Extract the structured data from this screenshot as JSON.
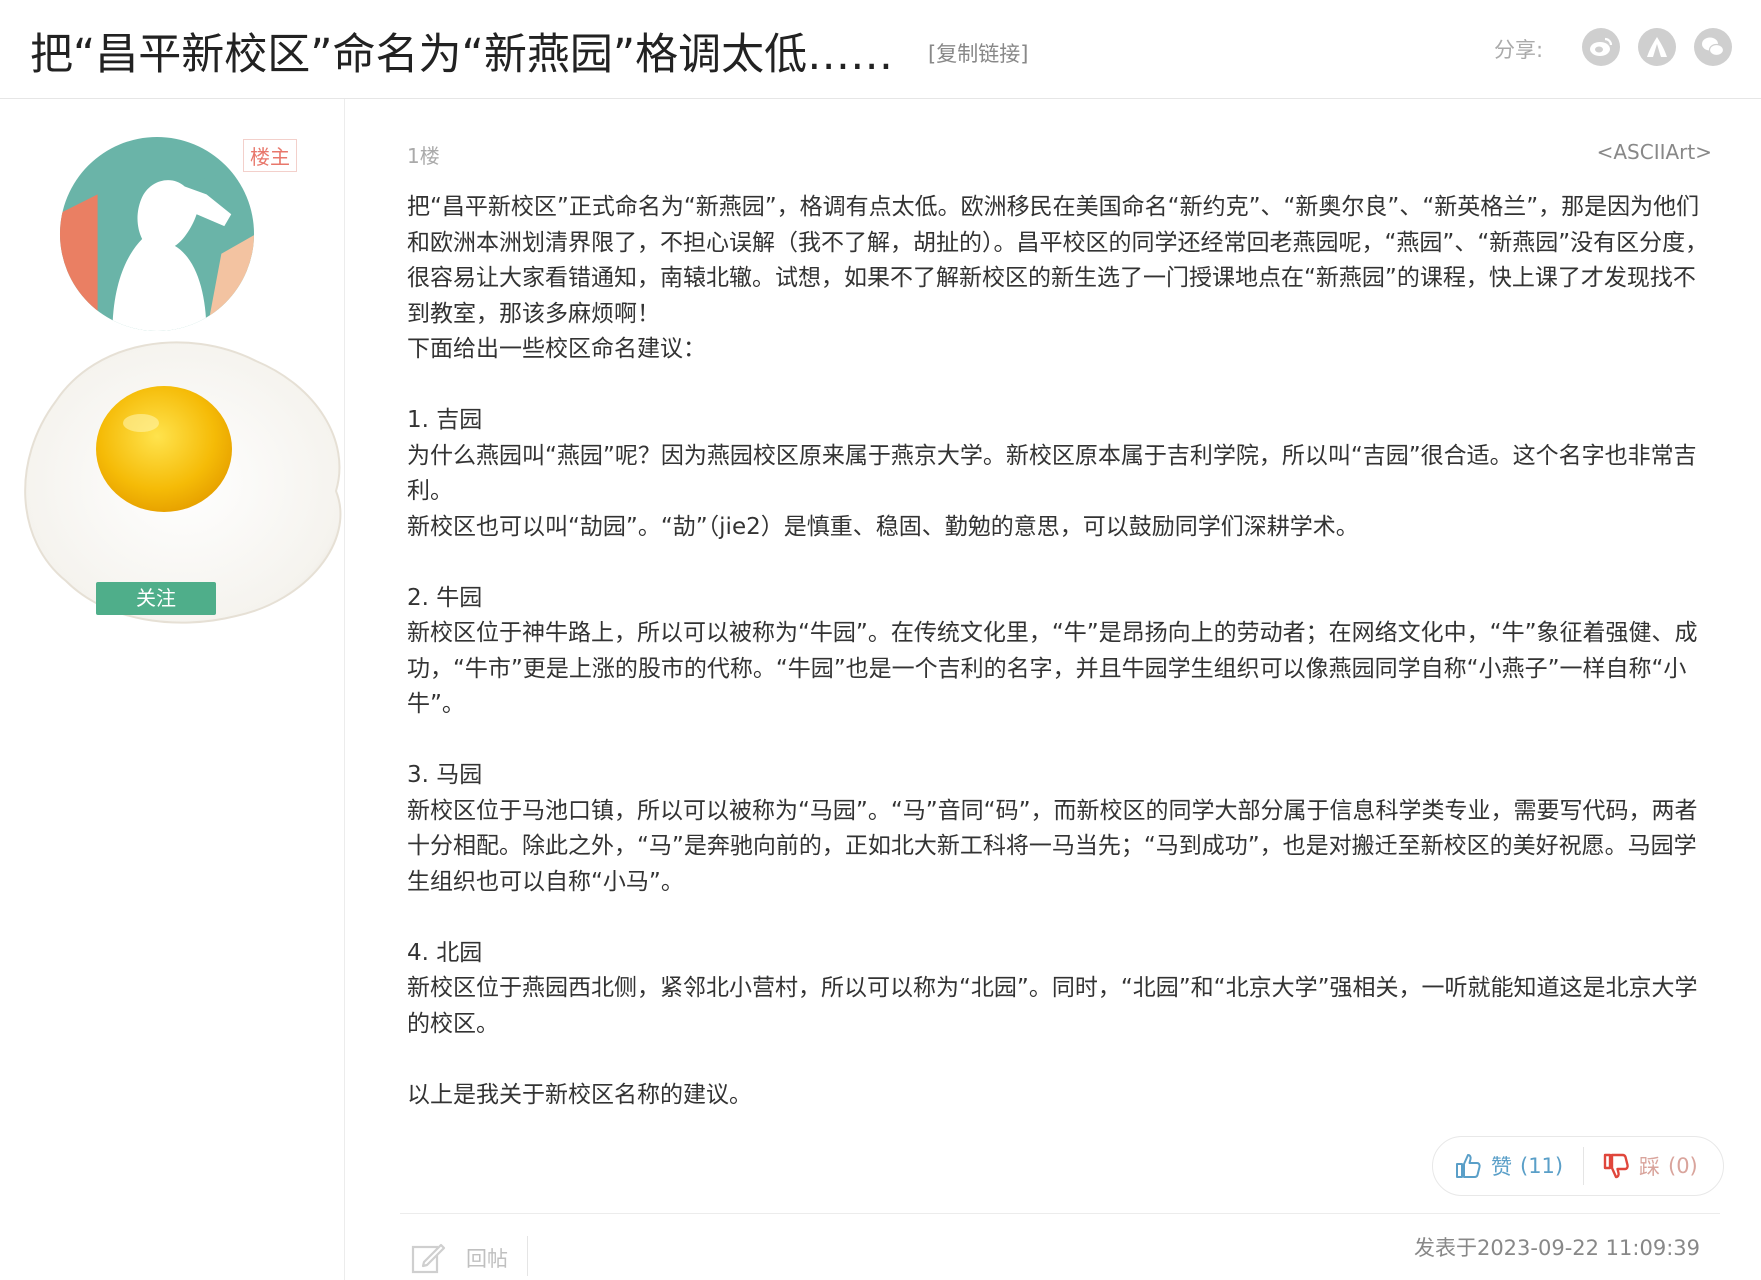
{
  "header": {
    "title": "把“昌平新校区”命名为“新燕园”格调太低……",
    "copy_link": "[复制链接]",
    "share_label": "分享:",
    "share_icons": [
      "weibo-icon",
      "renren-icon",
      "wechat-icon"
    ]
  },
  "user": {
    "op_badge": "楼主",
    "follow_label": "关注"
  },
  "post": {
    "floor": "1楼",
    "author": "<ASCIIArt>",
    "paragraphs": [
      "把“昌平新校区”正式命名为“新燕园”，格调有点太低。欧洲移民在美国命名“新约克”、“新奥尔良”、“新英格兰”，那是因为他们和欧洲本洲划清界限了，不担心误解（我不了解，胡扯的）。昌平校区的同学还经常回老燕园呢，“燕园”、“新燕园”没有区分度，很容易让大家看错通知，南辕北辙。试想，如果不了解新校区的新生选了一门授课地点在“新燕园”的课程，快上课了才发现找不到教室，那该多麻烦啊！",
      "下面给出一些校区命名建议：",
      "",
      "1. 吉园",
      "为什么燕园叫“燕园”呢？因为燕园校区原来属于燕京大学。新校区原本属于吉利学院，所以叫“吉园”很合适。这个名字也非常吉利。",
      "新校区也可以叫“劼园”。“劼”（jie2）是慎重、稳固、勤勉的意思，可以鼓励同学们深耕学术。",
      "",
      "2. 牛园",
      "新校区位于神牛路上，所以可以被称为“牛园”。在传统文化里，“牛”是昂扬向上的劳动者；在网络文化中，“牛”象征着强健、成功，“牛市”更是上涨的股市的代称。“牛园”也是一个吉利的名字，并且牛园学生组织可以像燕园同学自称“小燕子”一样自称“小牛”。",
      "",
      "3. 马园",
      "新校区位于马池口镇，所以可以被称为“马园”。“马”音同“码”，而新校区的同学大部分属于信息科学类专业，需要写代码，两者十分相配。除此之外，“马”是奔驰向前的，正如北大新工科将一马当先；“马到成功”，也是对搬迁至新校区的美好祝愿。马园学生组织也可以自称“小马”。",
      "",
      "4. 北园",
      "新校区位于燕园西北侧，紧邻北小营村，所以可以称为“北园”。同时，“北园”和“北京大学”强相关，一听就能知道这是北京大学的校区。",
      "",
      "以上是我关于新校区名称的建议。"
    ]
  },
  "actions": {
    "like_label": "赞",
    "like_count": "(11)",
    "dislike_label": "踩",
    "dislike_count": "(0)",
    "reply_label": "回帖",
    "post_time": "发表于2023-09-22 11:09:39"
  },
  "colors": {
    "follow_green": "#4fae8a",
    "op_badge_red": "#e8776b",
    "like_blue": "#5a9fc8",
    "dislike_red": "#e0463b"
  }
}
